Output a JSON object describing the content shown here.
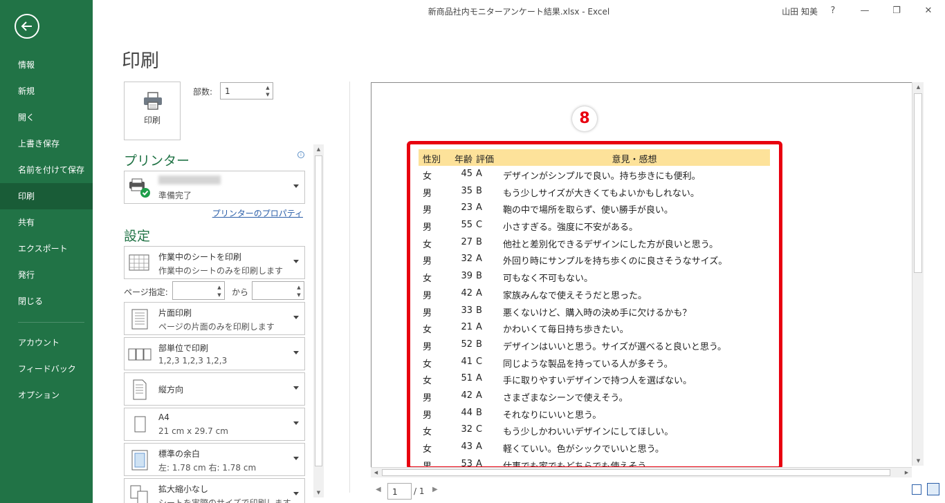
{
  "window": {
    "title": "新商品社内モニターアンケート結果.xlsx - Excel",
    "user": "山田 知美",
    "help": "?",
    "minimize": "—",
    "restore": "❐",
    "close": "✕"
  },
  "nav": {
    "items": [
      {
        "label": "情報",
        "active": false
      },
      {
        "label": "新規",
        "active": false
      },
      {
        "label": "開く",
        "active": false
      },
      {
        "label": "上書き保存",
        "active": false
      },
      {
        "label": "名前を付けて保存",
        "active": false
      },
      {
        "label": "印刷",
        "active": true
      },
      {
        "label": "共有",
        "active": false
      },
      {
        "label": "エクスポート",
        "active": false
      },
      {
        "label": "発行",
        "active": false
      },
      {
        "label": "閉じる",
        "active": false
      }
    ],
    "footer_items": [
      {
        "label": "アカウント"
      },
      {
        "label": "フィードバック"
      },
      {
        "label": "オプション"
      }
    ]
  },
  "print": {
    "heading": "印刷",
    "button_label": "印刷",
    "copies_label": "部数:",
    "copies_value": "1"
  },
  "printer": {
    "section_title": "プリンター",
    "status": "準備完了",
    "properties_link": "プリンターのプロパティ"
  },
  "settings": {
    "section_title": "設定",
    "scope": {
      "main": "作業中のシートを印刷",
      "sub": "作業中のシートのみを印刷します"
    },
    "page_range_label": "ページ指定:",
    "range_to_label": "から",
    "sides": {
      "main": "片面印刷",
      "sub": "ページの片面のみを印刷します"
    },
    "collate": {
      "main": "部単位で印刷",
      "sub": "1,2,3    1,2,3    1,2,3"
    },
    "orientation": {
      "main": "縦方向"
    },
    "paper": {
      "main": "A4",
      "sub": "21 cm x 29.7 cm"
    },
    "margins": {
      "main": "標準の余白",
      "sub": "左:  1.78 cm    右:  1.78 cm"
    },
    "scaling": {
      "main": "拡大縮小なし",
      "sub": "シートを実際のサイズで印刷します"
    }
  },
  "preview": {
    "marker": "8",
    "headers": {
      "sex": "性別",
      "age": "年齢",
      "grade": "評価",
      "opinion": "意見・感想"
    },
    "rows": [
      {
        "sex": "女",
        "age": "45",
        "grade": "A",
        "opinion": "デザインがシンプルで良い。持ち歩きにも便利。"
      },
      {
        "sex": "男",
        "age": "35",
        "grade": "B",
        "opinion": "もう少しサイズが大きくてもよいかもしれない。"
      },
      {
        "sex": "男",
        "age": "23",
        "grade": "A",
        "opinion": "鞄の中で場所を取らず、使い勝手が良い。"
      },
      {
        "sex": "男",
        "age": "55",
        "grade": "C",
        "opinion": "小さすぎる。強度に不安がある。"
      },
      {
        "sex": "女",
        "age": "27",
        "grade": "B",
        "opinion": "他社と差別化できるデザインにした方が良いと思う。"
      },
      {
        "sex": "男",
        "age": "32",
        "grade": "A",
        "opinion": "外回り時にサンプルを持ち歩くのに良さそうなサイズ。"
      },
      {
        "sex": "女",
        "age": "39",
        "grade": "B",
        "opinion": "可もなく不可もない。"
      },
      {
        "sex": "男",
        "age": "42",
        "grade": "A",
        "opinion": "家族みんなで使えそうだと思った。"
      },
      {
        "sex": "男",
        "age": "33",
        "grade": "B",
        "opinion": "悪くないけど、購入時の決め手に欠けるかも？"
      },
      {
        "sex": "女",
        "age": "21",
        "grade": "A",
        "opinion": "かわいくて毎日持ち歩きたい。"
      },
      {
        "sex": "男",
        "age": "52",
        "grade": "B",
        "opinion": "デザインはいいと思う。サイズが選べると良いと思う。"
      },
      {
        "sex": "女",
        "age": "41",
        "grade": "C",
        "opinion": "同じような製品を持っている人が多そう。"
      },
      {
        "sex": "女",
        "age": "51",
        "grade": "A",
        "opinion": "手に取りやすいデザインで持つ人を選ばない。"
      },
      {
        "sex": "男",
        "age": "42",
        "grade": "A",
        "opinion": "さまざまなシーンで使えそう。"
      },
      {
        "sex": "男",
        "age": "44",
        "grade": "B",
        "opinion": "それなりにいいと思う。"
      },
      {
        "sex": "女",
        "age": "32",
        "grade": "C",
        "opinion": "もう少しかわいいデザインにしてほしい。"
      },
      {
        "sex": "女",
        "age": "43",
        "grade": "A",
        "opinion": "軽くていい。色がシックでいいと思う。"
      },
      {
        "sex": "男",
        "age": "53",
        "grade": "A",
        "opinion": "仕事でも家でもどちらでも使えそう。"
      }
    ]
  },
  "page_nav": {
    "current": "1",
    "total": "/ 1"
  },
  "colors": {
    "nav_bg": "#217346",
    "nav_active": "#195c37",
    "accent": "#217346",
    "highlight": "#e8000f",
    "header_fill": "#fde29a"
  }
}
